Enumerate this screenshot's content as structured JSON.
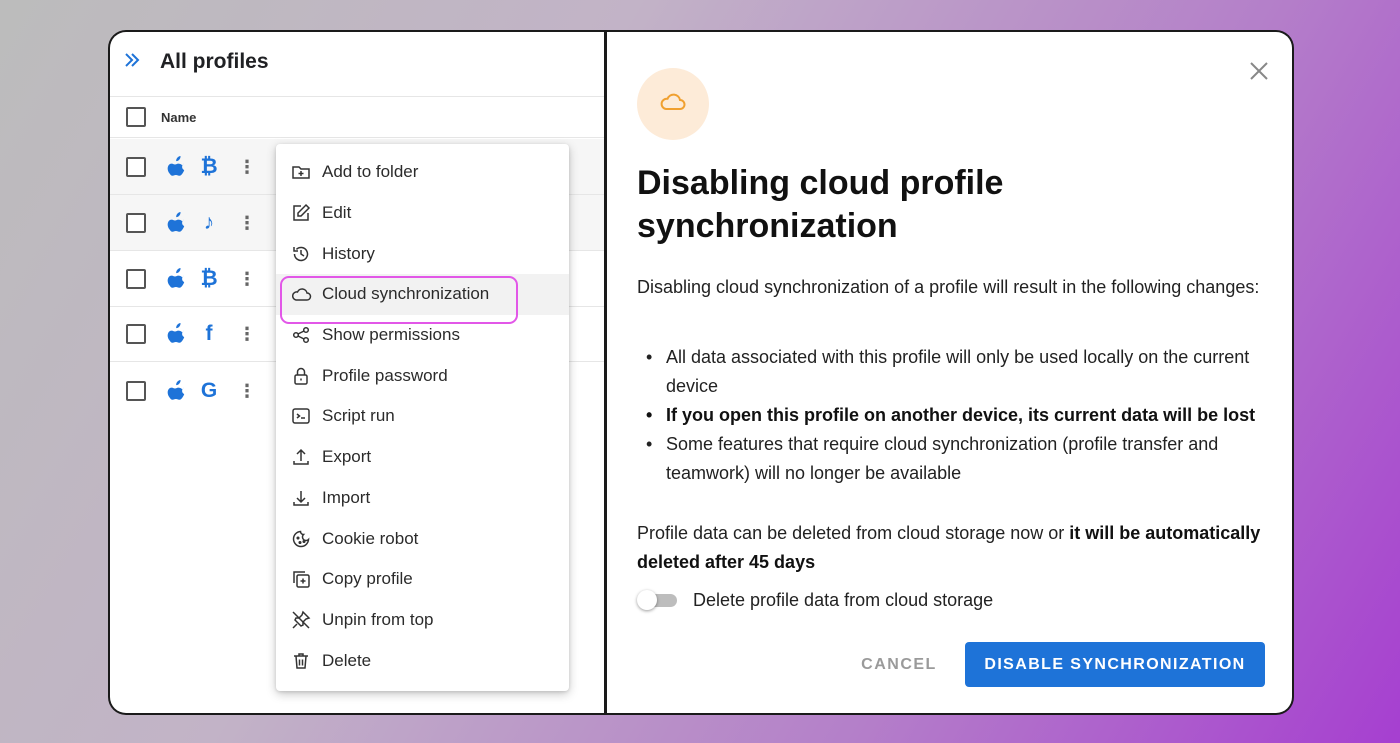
{
  "profiles_panel": {
    "title": "All profiles",
    "column_name": "Name",
    "rows": [
      {
        "os": "apple-icon",
        "brand": "bitcoin-icon",
        "brand_glyph": "₿"
      },
      {
        "os": "apple-icon",
        "brand": "tiktok-icon",
        "brand_glyph": "♪"
      },
      {
        "os": "apple-icon",
        "brand": "bitcoin-icon",
        "brand_glyph": "₿"
      },
      {
        "os": "apple-icon",
        "brand": "facebook-icon",
        "brand_glyph": "f"
      },
      {
        "os": "apple-icon",
        "brand": "google-icon",
        "brand_glyph": "G"
      }
    ]
  },
  "context_menu": {
    "items": [
      {
        "label": "Add to folder",
        "icon": "folder-add-icon"
      },
      {
        "label": "Edit",
        "icon": "edit-icon"
      },
      {
        "label": "History",
        "icon": "history-icon"
      },
      {
        "label": "Cloud synchronization",
        "icon": "cloud-icon",
        "active": true
      },
      {
        "label": "Show permissions",
        "icon": "share-icon"
      },
      {
        "label": "Profile password",
        "icon": "lock-icon"
      },
      {
        "label": "Script run",
        "icon": "terminal-icon"
      },
      {
        "label": "Export",
        "icon": "upload-icon"
      },
      {
        "label": "Import",
        "icon": "download-icon"
      },
      {
        "label": "Cookie robot",
        "icon": "cookie-icon"
      },
      {
        "label": "Copy profile",
        "icon": "copy-icon"
      },
      {
        "label": "Unpin from top",
        "icon": "unpin-icon"
      },
      {
        "label": "Delete",
        "icon": "trash-icon"
      }
    ]
  },
  "dialog": {
    "title": "Disabling cloud profile synchronization",
    "intro": "Disabling cloud synchronization of a profile will result in the following changes:",
    "bullets": [
      "All data associated with this profile will only be used locally on the current device",
      "If you open this profile on another device, its current data will be lost",
      "Some features that require cloud synchronization (profile transfer and teamwork) will no longer be available"
    ],
    "note_prefix": "Profile data can be deleted from cloud storage now or ",
    "note_bold": "it will be automatically deleted after 45 days",
    "toggle_label": "Delete profile data from cloud storage",
    "toggle_on": false,
    "cancel_label": "CANCEL",
    "confirm_label": "DISABLE SYNCHRONIZATION"
  },
  "colors": {
    "accent": "#1e73d8",
    "highlight": "#e257e8",
    "cloud_badge": "#fdebd8",
    "cloud_icon": "#f0a030"
  }
}
